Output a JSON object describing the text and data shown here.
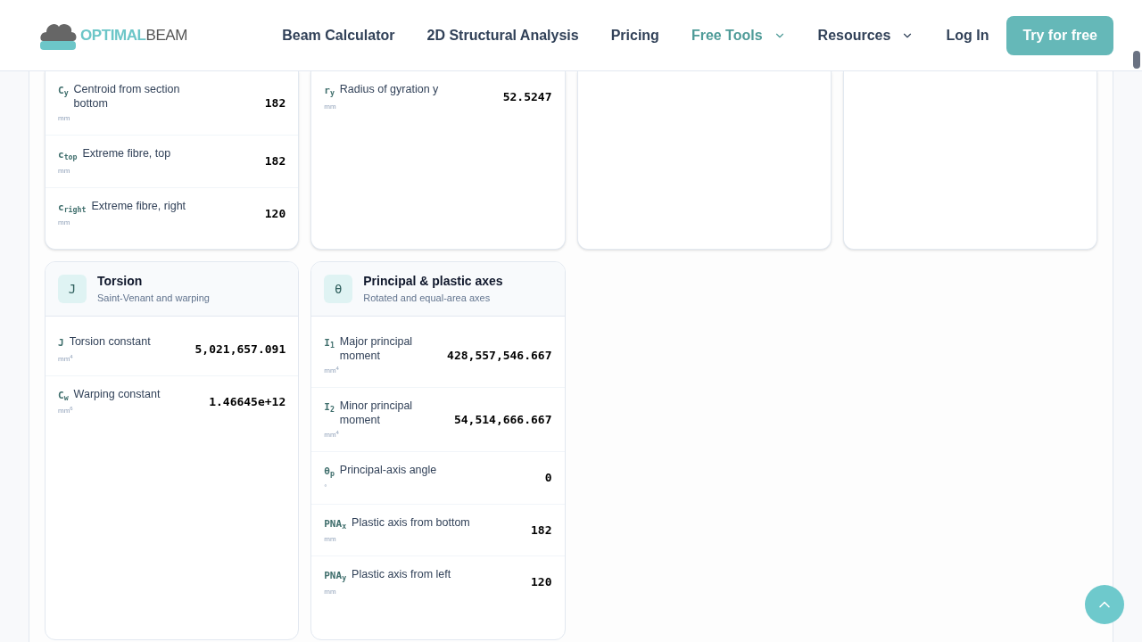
{
  "header": {
    "logo": {
      "bold": "OPTIMAL",
      "light": "BEAM"
    },
    "nav": [
      {
        "label": "Beam Calculator",
        "selected": false,
        "has_menu": false
      },
      {
        "label": "2D Structural Analysis",
        "selected": false,
        "has_menu": false
      },
      {
        "label": "Pricing",
        "selected": false,
        "has_menu": false
      },
      {
        "label": "Free Tools",
        "selected": true,
        "has_menu": true
      },
      {
        "label": "Resources",
        "selected": false,
        "has_menu": true
      },
      {
        "label": "Log In",
        "selected": false,
        "has_menu": false
      }
    ],
    "cta": "Try for free"
  },
  "top_cards": [
    {
      "rows": [
        {
          "symbol": "C$_{y}$",
          "label": "Centroid from section bottom",
          "unit": "mm",
          "value": "182"
        },
        {
          "symbol": "c$_{top}$",
          "label": "Extreme fibre, top",
          "unit": "mm",
          "value": "182"
        },
        {
          "symbol": "c$_{right}$",
          "label": "Extreme fibre, right",
          "unit": "mm",
          "value": "120"
        }
      ]
    },
    {
      "rows": [
        {
          "symbol": "r$_{y}$",
          "label": "Radius of gyration y",
          "unit": "mm",
          "value": "52.5247"
        }
      ]
    }
  ],
  "cards": [
    {
      "icon": "J",
      "title": "Torsion",
      "subtitle": "Saint-Venant and warping",
      "rows": [
        {
          "symbol": "J",
          "label": "Torsion constant",
          "unit": "mm$^{4}$",
          "value": "5,021,657.091"
        },
        {
          "symbol": "C$_{w}$",
          "label": "Warping constant",
          "unit": "mm$^{6}$",
          "value": "1.46645e+12"
        }
      ]
    },
    {
      "icon": "θ",
      "title": "Principal & plastic axes",
      "subtitle": "Rotated and equal-area axes",
      "rows": [
        {
          "symbol": "I$_{1}$",
          "label": "Major principal moment",
          "unit": "mm$^{4}$",
          "value": "428,557,546.667"
        },
        {
          "symbol": "I$_{2}$",
          "label": "Minor principal moment",
          "unit": "mm$^{4}$",
          "value": "54,514,666.667"
        },
        {
          "symbol": "θ$_{p}$",
          "label": "Principal-axis angle",
          "unit": "°",
          "value": "0"
        },
        {
          "symbol": "PNA$_{x}$",
          "label": "Plastic axis from bottom",
          "unit": "mm",
          "value": "182"
        },
        {
          "symbol": "PNA$_{y}$",
          "label": "Plastic axis from left",
          "unit": "mm",
          "value": "120"
        }
      ]
    }
  ]
}
